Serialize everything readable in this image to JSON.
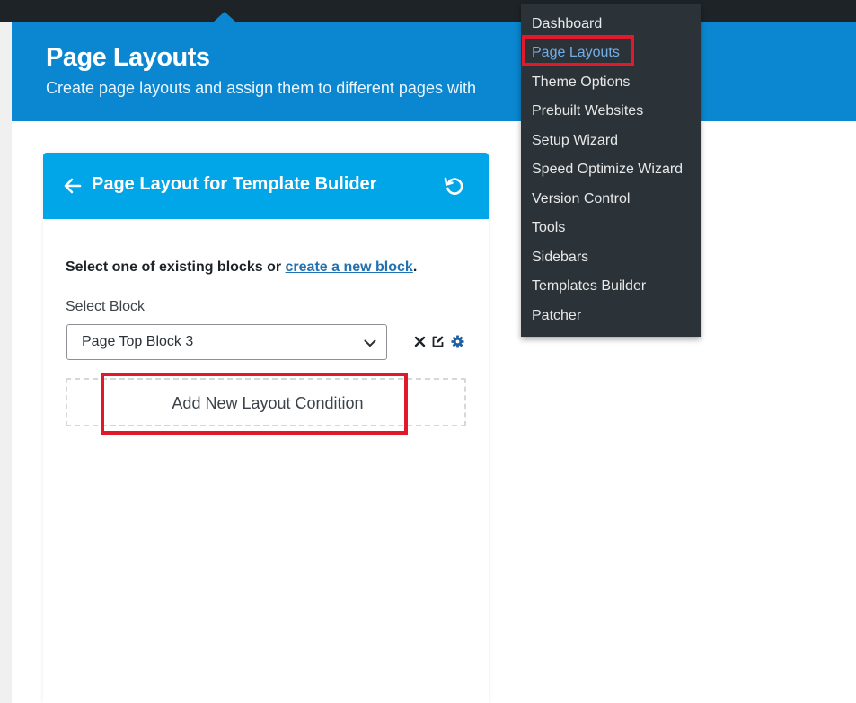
{
  "header": {
    "title": "Page Layouts",
    "subtitle": "Create page layouts and assign them to different pages with"
  },
  "card": {
    "title": "Page Layout for Template Bulider",
    "back_icon": "arrow-left-icon",
    "reset_icon": "undo-icon",
    "intro_prefix": "Select one of existing blocks or ",
    "intro_link": "create a new block",
    "intro_suffix": ".",
    "select_label": "Select Block",
    "select_value": "Page Top Block 3",
    "tool_icons": [
      "close-icon",
      "edit-icon",
      "gear-icon"
    ],
    "add_condition_label": "Add New Layout Condition"
  },
  "menu": {
    "items": [
      {
        "label": "Dashboard"
      },
      {
        "label": "Page Layouts"
      },
      {
        "label": "Theme Options"
      },
      {
        "label": "Prebuilt Websites"
      },
      {
        "label": "Setup Wizard"
      },
      {
        "label": "Speed Optimize Wizard"
      },
      {
        "label": "Version Control"
      },
      {
        "label": "Tools"
      },
      {
        "label": "Sidebars"
      },
      {
        "label": "Templates Builder"
      },
      {
        "label": "Patcher"
      }
    ],
    "active_index": 1
  },
  "colors": {
    "header_band": "#0a87d0",
    "card_header": "#00a6e8",
    "menu_bg": "#2c3338",
    "menu_active": "#72aee6",
    "highlight": "#e0192b",
    "link": "#2271b1"
  }
}
